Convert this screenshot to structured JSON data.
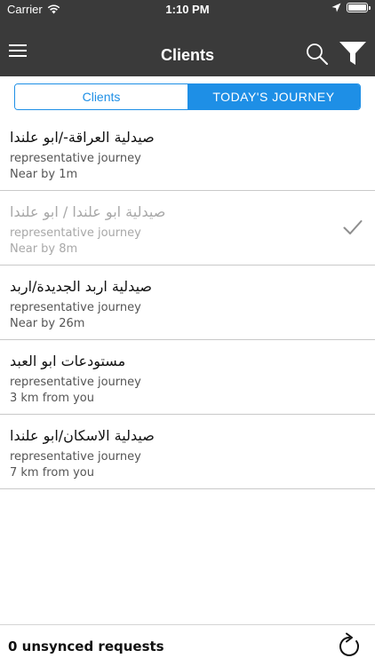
{
  "status_bar": {
    "carrier": "Carrier",
    "time": "1:10 PM"
  },
  "nav": {
    "title": "Clients"
  },
  "segments": [
    {
      "label": "Clients",
      "selected": false
    },
    {
      "label": "TODAY'S JOURNEY",
      "selected": true
    }
  ],
  "clients": [
    {
      "name": "صيدلية العراقة-/ابو علندا",
      "subtitle": "representative journey",
      "distance": "Near by 1m",
      "visited": false
    },
    {
      "name": "صيدلية ابو علندا / ابو علندا",
      "subtitle": "representative journey",
      "distance": "Near by 8m",
      "visited": true
    },
    {
      "name": "صيدلية اربد الجديدة/اربد",
      "subtitle": "representative journey",
      "distance": "Near by 26m",
      "visited": false
    },
    {
      "name": "مستودعات ابو العبد",
      "subtitle": "representative journey",
      "distance": "3 km from you",
      "visited": false
    },
    {
      "name": "صيدلية الاسكان/ابو علندا",
      "subtitle": "representative journey",
      "distance": "7 km from you",
      "visited": false
    }
  ],
  "footer": {
    "unsynced_label": "0 unsynced requests"
  },
  "colors": {
    "bar": "#3a3a3a",
    "accent": "#1e8fe6",
    "divider": "#c9c9c9"
  },
  "icons": [
    "wifi-icon",
    "location-arrow-icon",
    "battery-icon",
    "hamburger-menu-icon",
    "search-icon",
    "filter-icon",
    "checkmark-icon",
    "refresh-icon"
  ]
}
